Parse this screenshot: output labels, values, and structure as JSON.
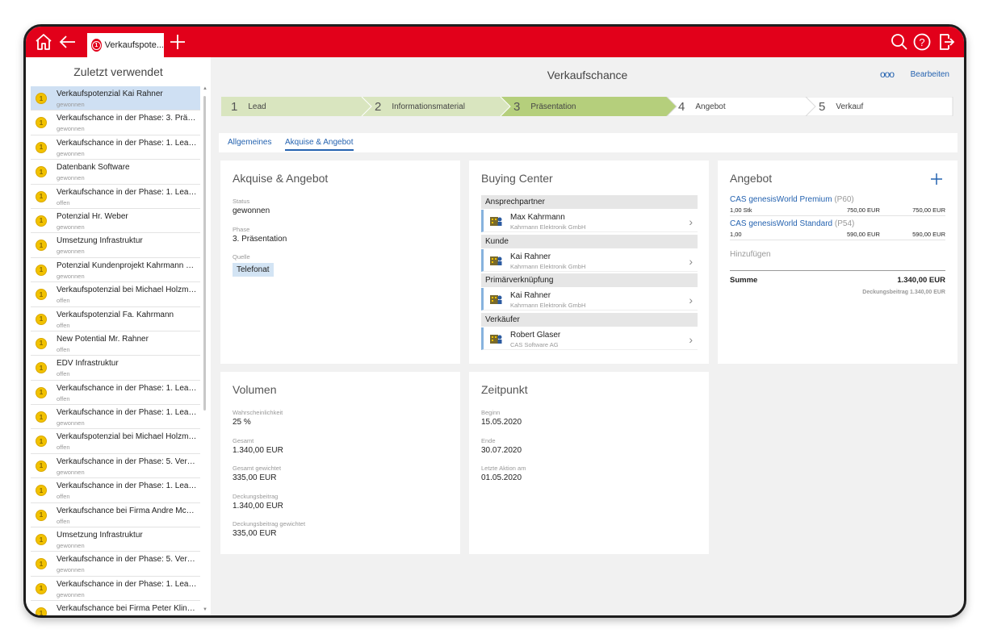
{
  "topbar": {
    "tab_label": "Verkaufspote...",
    "icons": [
      "home-icon",
      "back-icon",
      "add-tab-icon",
      "search-icon",
      "help-icon",
      "logout-icon"
    ]
  },
  "sidebar": {
    "title": "Zuletzt verwendet",
    "items": [
      {
        "title": "Verkaufspotenzial Kai Rahner",
        "status": "gewonnen"
      },
      {
        "title": "Verkaufschance in der Phase: 3. Präsen...",
        "status": "gewonnen"
      },
      {
        "title": "Verkaufschance in der Phase: 1. Lead ...",
        "status": "gewonnen"
      },
      {
        "title": "Datenbank Software",
        "status": "gewonnen"
      },
      {
        "title": "Verkaufschance in der Phase: 1. Lead ...",
        "status": "offen"
      },
      {
        "title": "Potenzial Hr. Weber",
        "status": "gewonnen"
      },
      {
        "title": "Umsetzung Infrastruktur",
        "status": "gewonnen"
      },
      {
        "title": "Potenzial Kundenprojekt Kahrmann Ele...",
        "status": "gewonnen"
      },
      {
        "title": "Verkaufspotenzial bei Michael Holzma...",
        "status": "offen"
      },
      {
        "title": "Verkaufspotenzial Fa. Kahrmann",
        "status": "offen"
      },
      {
        "title": "New Potential Mr. Rahner",
        "status": "offen"
      },
      {
        "title": "EDV Infrastruktur",
        "status": "offen"
      },
      {
        "title": "Verkaufschance in der Phase: 1. Lead ...",
        "status": "offen"
      },
      {
        "title": "Verkaufschance in der Phase: 1. Lead ...",
        "status": "gewonnen"
      },
      {
        "title": "Verkaufspotenzial bei Michael Holzma...",
        "status": "offen"
      },
      {
        "title": "Verkaufschance in der Phase: 5. Verkau...",
        "status": "gewonnen"
      },
      {
        "title": "Verkaufschance in der Phase: 1. Lead ...",
        "status": "offen"
      },
      {
        "title": "Verkaufschance bei Firma Andre McKe...",
        "status": "offen"
      },
      {
        "title": "Umsetzung Infrastruktur",
        "status": "gewonnen"
      },
      {
        "title": "Verkaufschance in der Phase: 5. Verkau...",
        "status": "gewonnen"
      },
      {
        "title": "Verkaufschance in der Phase: 1. Lead ...",
        "status": "gewonnen"
      },
      {
        "title": "Verkaufschance bei Firma Peter Kling, T...",
        "status": ""
      }
    ]
  },
  "header": {
    "title": "Verkaufschance",
    "more": "ooo",
    "edit": "Bearbeiten"
  },
  "steps": [
    {
      "num": "1",
      "label": "Lead"
    },
    {
      "num": "2",
      "label": "Informationsmaterial"
    },
    {
      "num": "3",
      "label": "Präsentation"
    },
    {
      "num": "4",
      "label": "Angebot"
    },
    {
      "num": "5",
      "label": "Verkauf"
    }
  ],
  "tabs": {
    "general": "Allgemeines",
    "akquise": "Akquise & Angebot"
  },
  "akquise": {
    "title": "Akquise & Angebot",
    "status_label": "Status",
    "status": "gewonnen",
    "phase_label": "Phase",
    "phase": "3. Präsentation",
    "source_label": "Quelle",
    "source": "Telefonat"
  },
  "buying_center": {
    "title": "Buying Center",
    "groups": [
      {
        "role": "Ansprechpartner",
        "name": "Max Kahrmann",
        "company": "Kahrmann Elektronik GmbH"
      },
      {
        "role": "Kunde",
        "name": "Kai Rahner",
        "company": "Kahrmann Elektronik GmbH"
      },
      {
        "role": "Primärverknüpfung",
        "name": "Kai Rahner",
        "company": "Kahrmann Elektronik GmbH"
      },
      {
        "role": "Verkäufer",
        "name": "Robert Glaser",
        "company": "CAS Software AG"
      }
    ]
  },
  "angebot": {
    "title": "Angebot",
    "products": [
      {
        "name": "CAS genesisWorld Premium",
        "code": "(P60)",
        "qty": "1,00 Stk",
        "price": "750,00 EUR",
        "total": "750,00 EUR"
      },
      {
        "name": "CAS genesisWorld Standard",
        "code": "(P54)",
        "qty": "1,00",
        "price": "590,00 EUR",
        "total": "590,00 EUR"
      }
    ],
    "add": "Hinzufügen",
    "sum_label": "Summe",
    "sum": "1.340,00 EUR",
    "margin": "Deckungsbeitrag 1.340,00 EUR"
  },
  "volumen": {
    "title": "Volumen",
    "fields": [
      {
        "label": "Wahrscheinlichkeit",
        "value": "25 %"
      },
      {
        "label": "Gesamt",
        "value": "1.340,00 EUR"
      },
      {
        "label": "Gesamt gewichtet",
        "value": "335,00 EUR"
      },
      {
        "label": "Deckungsbeitrag",
        "value": "1.340,00 EUR"
      },
      {
        "label": "Deckungsbeitrag gewichtet",
        "value": "335,00 EUR"
      }
    ]
  },
  "zeitpunkt": {
    "title": "Zeitpunkt",
    "fields": [
      {
        "label": "Beginn",
        "value": "15.05.2020"
      },
      {
        "label": "Ende",
        "value": "30.07.2020"
      },
      {
        "label": "Letzte Aktion am",
        "value": "01.05.2020"
      }
    ]
  },
  "colors": {
    "brand": "#e2001a",
    "link": "#2563b0",
    "step_done": "#d9e5bf",
    "step_active": "#b5cf7c"
  }
}
